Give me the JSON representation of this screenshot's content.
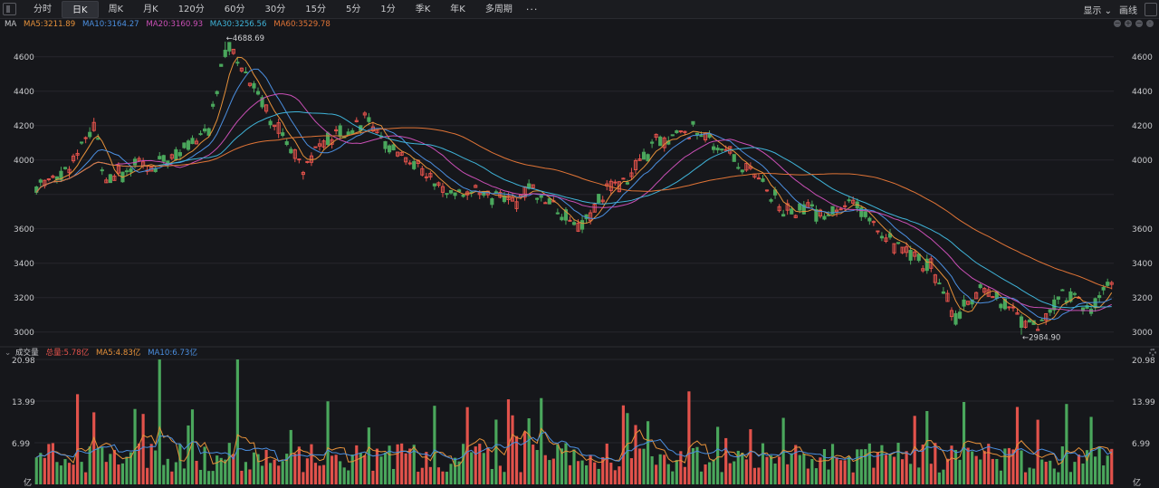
{
  "toolbar": {
    "tabs": [
      "分时",
      "日K",
      "周K",
      "月K",
      "120分",
      "60分",
      "30分",
      "15分",
      "5分",
      "1分",
      "季K",
      "年K",
      "多周期"
    ],
    "active_tab": "日K",
    "more_label": "···",
    "display_label": "显示",
    "draw_label": "画线"
  },
  "price_legend": {
    "name": "MA",
    "ma5": "MA5:3211.89",
    "ma10": "MA10:3164.27",
    "ma20": "MA20:3160.93",
    "ma30": "MA30:3256.56",
    "ma60": "MA60:3529.78"
  },
  "volume_legend": {
    "name": "成交量",
    "total": "总量:5.78亿",
    "ma5": "MA5:4.83亿",
    "ma10": "MA10:6.73亿"
  },
  "colors": {
    "up": "#e2524b",
    "down": "#4aa75c",
    "ma5": "#e6913a",
    "ma10": "#4b8fe0",
    "ma20": "#c94fb5",
    "ma30": "#3fb3d8",
    "ma60": "#e07436",
    "grid": "#26272c",
    "axis_text": "#c8c9cc"
  },
  "chart_data": {
    "type": "candlestick",
    "price_axis": {
      "ticks": [
        3000,
        3200,
        3400,
        3600,
        3800,
        4000,
        4200,
        4400,
        4600
      ],
      "tick_labels": [
        "3000",
        "3200",
        "3400",
        "3600",
        "",
        "4000",
        "4200",
        "4400",
        "4600"
      ],
      "ylim": [
        2920,
        4720
      ]
    },
    "volume_axis": {
      "ticks": [
        6.99,
        13.99,
        20.98
      ],
      "tick_labels": [
        "6.99",
        "13.99",
        "20.98"
      ],
      "unit": "亿",
      "ylim": [
        0,
        20.98
      ]
    },
    "high_label": "←4688.69",
    "low_label": "←2984.90",
    "high": 4688.69,
    "low": 2984.9,
    "volume_unit": "亿"
  }
}
